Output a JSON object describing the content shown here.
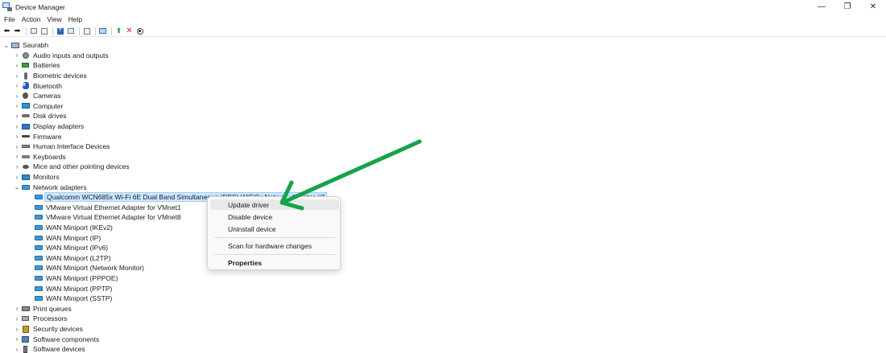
{
  "window": {
    "title": "Device Manager",
    "controls": {
      "minimize": "—",
      "maximize": "❐",
      "close": "✕"
    }
  },
  "menu": [
    "File",
    "Action",
    "View",
    "Help"
  ],
  "toolbar_icons": [
    "back-icon",
    "forward-icon",
    "show-hide-tree-icon",
    "properties-icon",
    "help-icon",
    "device-view-icon",
    "print-icon",
    "monitor-icon",
    "update-driver-icon",
    "uninstall-icon",
    "download-icon"
  ],
  "tree": {
    "root": "Saurabh",
    "categories": [
      {
        "label": "Audio inputs and outputs",
        "icon": "speaker-icon"
      },
      {
        "label": "Batteries",
        "icon": "battery-icon"
      },
      {
        "label": "Biometric devices",
        "icon": "fingerprint-icon"
      },
      {
        "label": "Bluetooth",
        "icon": "bluetooth-icon"
      },
      {
        "label": "Cameras",
        "icon": "camera-icon"
      },
      {
        "label": "Computer",
        "icon": "computer-icon"
      },
      {
        "label": "Disk drives",
        "icon": "disk-icon"
      },
      {
        "label": "Display adapters",
        "icon": "display-adapter-icon"
      },
      {
        "label": "Firmware",
        "icon": "firmware-icon"
      },
      {
        "label": "Human Interface Devices",
        "icon": "hid-icon"
      },
      {
        "label": "Keyboards",
        "icon": "keyboard-icon"
      },
      {
        "label": "Mice and other pointing devices",
        "icon": "mouse-icon"
      },
      {
        "label": "Monitors",
        "icon": "monitor-icon"
      },
      {
        "label": "Network adapters",
        "icon": "network-adapter-icon",
        "expanded": true
      }
    ],
    "network_adapters": [
      "Qualcomm WCN685x Wi-Fi 6E Dual Band Simultaneous (DBS) WiFiCx Network Adapter #2",
      "VMware Virtual Ethernet Adapter for VMnet1",
      "VMware Virtual Ethernet Adapter for VMnet8",
      "WAN Miniport (IKEv2)",
      "WAN Miniport (IP)",
      "WAN Miniport (IPv6)",
      "WAN Miniport (L2TP)",
      "WAN Miniport (Network Monitor)",
      "WAN Miniport (PPPOE)",
      "WAN Miniport (PPTP)",
      "WAN Miniport (SSTP)"
    ],
    "after_categories": [
      {
        "label": "Print queues",
        "icon": "printer-icon"
      },
      {
        "label": "Processors",
        "icon": "processor-icon"
      },
      {
        "label": "Security devices",
        "icon": "security-icon"
      },
      {
        "label": "Software components",
        "icon": "software-component-icon"
      },
      {
        "label": "Software devices",
        "icon": "software-device-icon"
      }
    ]
  },
  "context_menu": {
    "update_driver": "Update driver",
    "disable_device": "Disable device",
    "uninstall_device": "Uninstall device",
    "scan": "Scan for hardware changes",
    "properties": "Properties"
  },
  "colors": {
    "selection": "#cce8ff",
    "arrow": "#16a34a"
  }
}
